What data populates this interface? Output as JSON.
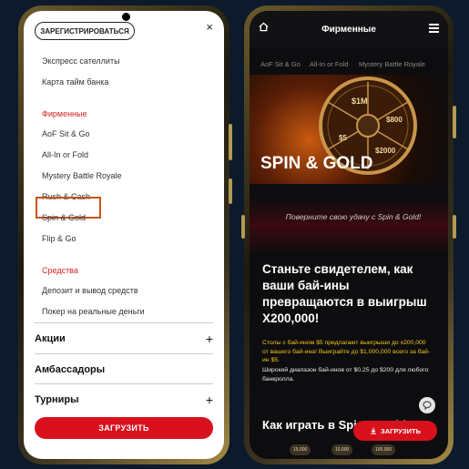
{
  "left": {
    "register_label": "ЗАРЕГИСТРИРОВАТЬСЯ",
    "close_glyph": "×",
    "items_top": [
      {
        "label": "Экспресс сателлиты"
      },
      {
        "label": "Карта тайм банка"
      }
    ],
    "section_branded": "Фирменные",
    "branded_items": [
      {
        "label": "AoF Sit & Go"
      },
      {
        "label": "All-In or Fold"
      },
      {
        "label": "Mystery Battle Royale"
      },
      {
        "label": "Rush & Cash"
      },
      {
        "label": "Spin & Gold"
      },
      {
        "label": "Flip & Go"
      }
    ],
    "section_funds": "Средства",
    "funds_items": [
      {
        "label": "Депозит и вывод средств"
      },
      {
        "label": "Покер на реальные деньги"
      }
    ],
    "accordion": [
      {
        "label": "Акции",
        "plus": "+"
      },
      {
        "label": "Амбассадоры",
        "plus": ""
      },
      {
        "label": "Турниры",
        "plus": "+"
      }
    ],
    "download_label": "ЗАГРУЗИТЬ"
  },
  "right": {
    "header_title": "Фирменные",
    "subnav": [
      "AoF Sit & Go",
      "All-In or Fold",
      "Mystery Battle Royale"
    ],
    "wheel_labels": [
      "$1M",
      "$800",
      "$2000",
      "$5"
    ],
    "hero_title": "SPIN & GOLD",
    "banner_text": "Поверните свою удачу с Spin & Gold!",
    "headline": "Станьте свидетелем, как ваши бай-ины превращаются в выигрыш X200,000!",
    "promo_text": "Столы с бай-ином $5 предлагают выигрыши до x200,000 от вашего бай-ина! Выиграйте до $1,000,000 всего за бай-ин $5.",
    "promo_text2": "Широкий диапазон бай-инов от $0.25 до $200 для любого банкролла.",
    "how_to": "Как играть в Spin & Gold",
    "download_label": "ЗАГРУЗИТЬ",
    "chips": [
      "15,000",
      "10,000",
      "100,000"
    ]
  }
}
